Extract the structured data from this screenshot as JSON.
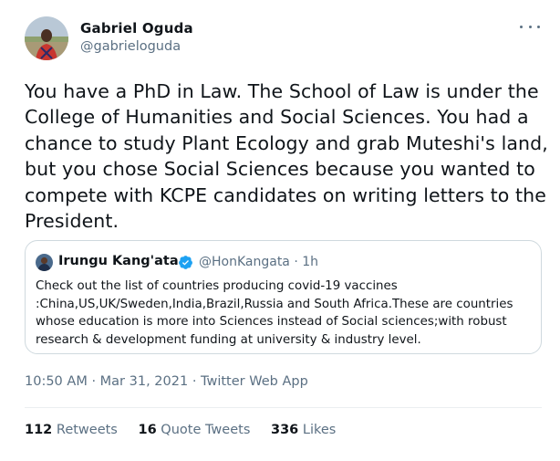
{
  "author": {
    "name": "Gabriel Oguda",
    "handle": "@gabrieloguda"
  },
  "tweet": {
    "text": "You have a PhD in Law. The School of Law is under the College of Humanities and Social Sciences. You had a chance to study Plant Ecology and grab Muteshi's land, but you chose Social Sciences because you wanted to compete with KCPE candidates on writing letters to the President."
  },
  "quote": {
    "name": "Irungu Kang'ata",
    "handle_time": "@HonKangata · 1h",
    "text": "Check out the list of countries producing covid-19 vaccines :China,US,UK/Sweden,India,Brazil,Russia and South Africa.These are countries whose education is more into Sciences instead of Social sciences;with robust research & development funding at university & industry level.",
    "verified": true
  },
  "meta": {
    "time": "10:50 AM",
    "date": "Mar 31, 2021",
    "app": "Twitter Web App"
  },
  "stats": {
    "retweets_count": "112",
    "retweets_label": "Retweets",
    "quotes_count": "16",
    "quotes_label": "Quote Tweets",
    "likes_count": "336",
    "likes_label": "Likes"
  },
  "colors": {
    "text": "#0f1419",
    "secondary": "#5b7083",
    "border": "#cfd9de",
    "verified": "#1da1f2"
  },
  "icons": [
    "more-icon",
    "verified-badge-icon"
  ]
}
